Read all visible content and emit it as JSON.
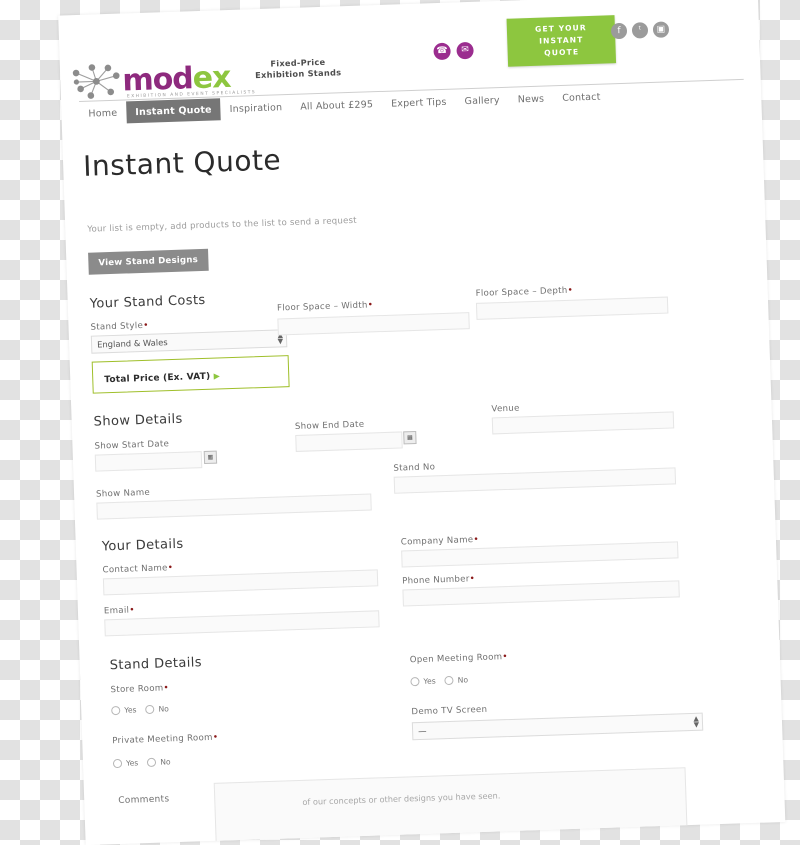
{
  "site": {
    "logo": {
      "part1": "mod",
      "part2": "ex",
      "tagline": "EXHIBITION AND EVENT SPECIALISTS"
    },
    "header_tagline_line1": "Fixed-Price",
    "header_tagline_line2": "Exhibition Stands",
    "cta_button": "GET YOUR\nINSTANT\nQUOTE",
    "contact_icons": [
      {
        "name": "phone-icon",
        "glyph": "☎"
      },
      {
        "name": "email-icon",
        "glyph": "✉"
      }
    ],
    "social_icons": [
      {
        "name": "facebook-icon",
        "glyph": "f"
      },
      {
        "name": "twitter-icon",
        "glyph": "ᵗ"
      },
      {
        "name": "instagram-icon",
        "glyph": "▣"
      }
    ]
  },
  "nav": {
    "items": [
      {
        "label": "Home",
        "active": false
      },
      {
        "label": "Instant Quote",
        "active": true
      },
      {
        "label": "Inspiration",
        "active": false
      },
      {
        "label": "All About £295",
        "active": false
      },
      {
        "label": "Expert Tips",
        "active": false
      },
      {
        "label": "Gallery",
        "active": false
      },
      {
        "label": "News",
        "active": false
      },
      {
        "label": "Contact",
        "active": false
      }
    ]
  },
  "page": {
    "title": "Instant Quote",
    "empty_message": "Your list is empty, add products to the list to send a request",
    "view_designs_button": "View Stand Designs"
  },
  "stand_costs": {
    "heading": "Your Stand Costs",
    "stand_style_label": "Stand Style",
    "stand_style_value": "England & Wales",
    "floor_width_label": "Floor Space – Width",
    "floor_width_value": "",
    "floor_depth_label": "Floor Space – Depth",
    "floor_depth_value": "",
    "total_price_label": "Total Price (Ex. VAT)",
    "total_price_arrow": "▶"
  },
  "show_details": {
    "heading": "Show Details",
    "start_date_label": "Show Start Date",
    "start_date_value": "",
    "end_date_label": "Show End Date",
    "end_date_value": "",
    "venue_label": "Venue",
    "venue_value": "",
    "show_name_label": "Show Name",
    "show_name_value": "",
    "stand_no_label": "Stand No",
    "stand_no_value": "",
    "calendar_icon": "▦"
  },
  "your_details": {
    "heading": "Your Details",
    "contact_name_label": "Contact Name",
    "contact_name_value": "",
    "company_name_label": "Company Name",
    "company_name_value": "",
    "email_label": "Email",
    "email_value": "",
    "phone_label": "Phone Number",
    "phone_value": ""
  },
  "stand_details": {
    "heading": "Stand Details",
    "store_room_label": "Store Room",
    "private_meeting_label": "Private Meeting Room",
    "open_meeting_label": "Open Meeting Room",
    "demo_tv_label": "Demo TV Screen",
    "demo_tv_value": "—",
    "yes_label": "Yes",
    "no_label": "No"
  },
  "comments": {
    "heading": "Comments",
    "hint": "of our concepts or other designs you have seen."
  },
  "required_marker": "•",
  "colors": {
    "brand_green": "#8dc63f",
    "brand_purple": "#8e2a7e",
    "accent_purple_icon": "#9b2d8f",
    "nav_active": "#767676",
    "required_red": "#8b1a1a"
  }
}
